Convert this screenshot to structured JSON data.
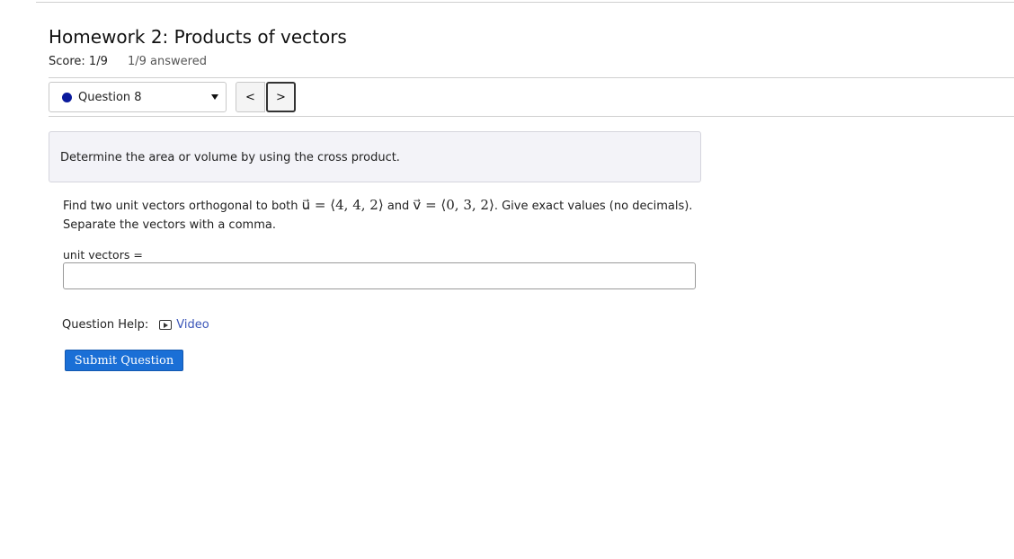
{
  "header": {
    "title": "Homework 2: Products of vectors",
    "score_label": "Score: 1/9",
    "answered_label": "1/9 answered"
  },
  "question_nav": {
    "selected": "Question 8",
    "prev_glyph": "<",
    "next_glyph": ">",
    "status_color": "#0a1a9c"
  },
  "intro": {
    "text": "Determine the area or volume by using the cross product."
  },
  "problem": {
    "text_1": "Find two unit vectors orthogonal to both ",
    "u_math": "u⃗ = ⟨4, 4, 2⟩",
    "text_2": " and ",
    "v_math": "v⃗ = ⟨0, 3, 2⟩",
    "text_3": ". Give exact values (no decimals).",
    "text_4": "Separate the vectors with a comma."
  },
  "answer": {
    "label": "unit vectors =",
    "value": "",
    "placeholder": ""
  },
  "help": {
    "label": "Question Help:",
    "video_label": "Video",
    "link_color": "#3a55b8"
  },
  "actions": {
    "submit_label": "Submit Question",
    "submit_color": "#1a6fd6"
  }
}
